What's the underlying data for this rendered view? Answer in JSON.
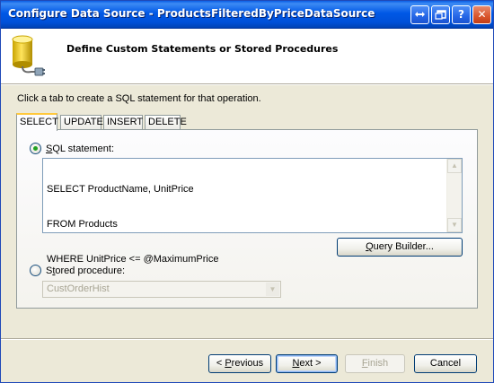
{
  "window": {
    "title": "Configure Data Source - ProductsFilteredByPriceDataSource",
    "controls": [
      "restore-icon",
      "maximize-icon",
      "help-icon",
      "close-icon"
    ],
    "help_glyph": "?",
    "close_glyph": "✕"
  },
  "header": {
    "icon": "database-icon",
    "heading": "Define Custom Statements or Stored Procedures"
  },
  "instruction": "Click a tab to create a SQL statement for that operation.",
  "tabs": [
    {
      "label": "SELECT",
      "active": true
    },
    {
      "label": "UPDATE",
      "active": false
    },
    {
      "label": "INSERT",
      "active": false
    },
    {
      "label": "DELETE",
      "active": false
    }
  ],
  "sql_statement": {
    "label_accel": "S",
    "label_rest": "QL statement:",
    "checked": true,
    "lines": [
      "SELECT ProductName, UnitPrice",
      "FROM Products",
      "WHERE UnitPrice <= @MaximumPrice"
    ]
  },
  "query_builder": {
    "accel": "Q",
    "rest": "uery Builder..."
  },
  "stored_procedure": {
    "label_before": "S",
    "label_accel": "t",
    "label_rest": "ored procedure:",
    "checked": false,
    "selected": "CustOrderHist"
  },
  "footer": {
    "previous": {
      "pre": "< ",
      "accel": "P",
      "rest": "revious"
    },
    "next": {
      "accel": "N",
      "rest": "ext >"
    },
    "finish": {
      "accel": "F",
      "rest": "inish",
      "enabled": false
    },
    "cancel": "Cancel"
  },
  "colors": {
    "titlebar": "#0058e6",
    "face": "#ece9d8",
    "tab_highlight": "#ffc83c",
    "radio_dot": "#21a121"
  }
}
